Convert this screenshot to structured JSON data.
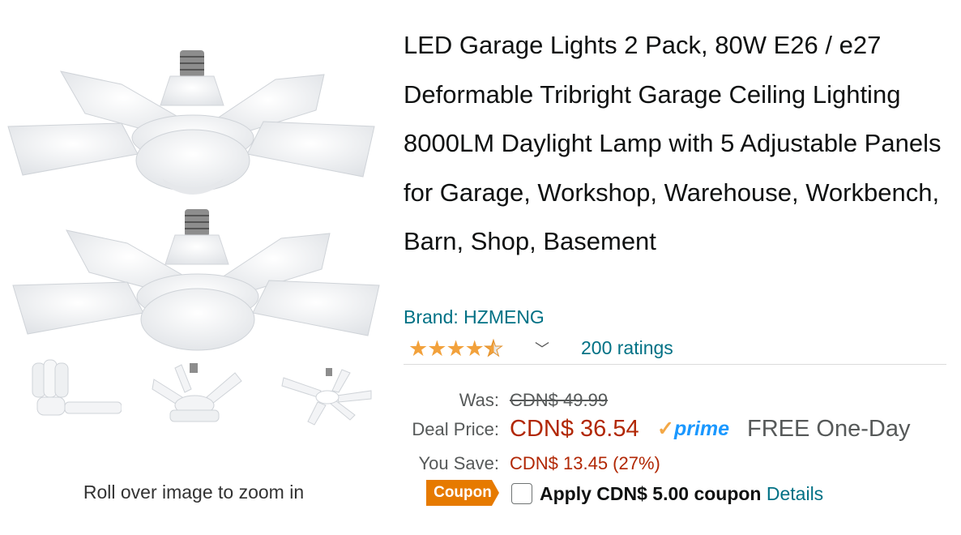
{
  "product": {
    "title": "LED Garage Lights 2 Pack, 80W E26 / e27 Deformable Tribright Garage Ceiling Lighting 8000LM Daylight Lamp with 5 Adjustable Panels for Garage, Workshop, Warehouse, Workbench, Barn, Shop, Basement",
    "brand": "Brand: HZMENG",
    "rating": 4.5,
    "ratings_count": "200 ratings"
  },
  "gallery": {
    "zoom_hint": "Roll over image to zoom in"
  },
  "pricing": {
    "was_label": "Was:",
    "was_value": "CDN$ 49.99",
    "deal_label": "Deal Price:",
    "deal_value": "CDN$ 36.54",
    "prime_label": "prime",
    "delivery": "FREE One-Day",
    "save_label": "You Save:",
    "save_value": "CDN$ 13.45 (27%)"
  },
  "coupon": {
    "badge": "Coupon",
    "text": "Apply CDN$ 5.00 coupon",
    "details_link": "Details"
  },
  "colors": {
    "price_red": "#b12704",
    "link_teal": "#007185",
    "star_orange": "#f2a13b",
    "coupon_orange": "#e67a00",
    "prime_blue": "#1a98ff"
  }
}
